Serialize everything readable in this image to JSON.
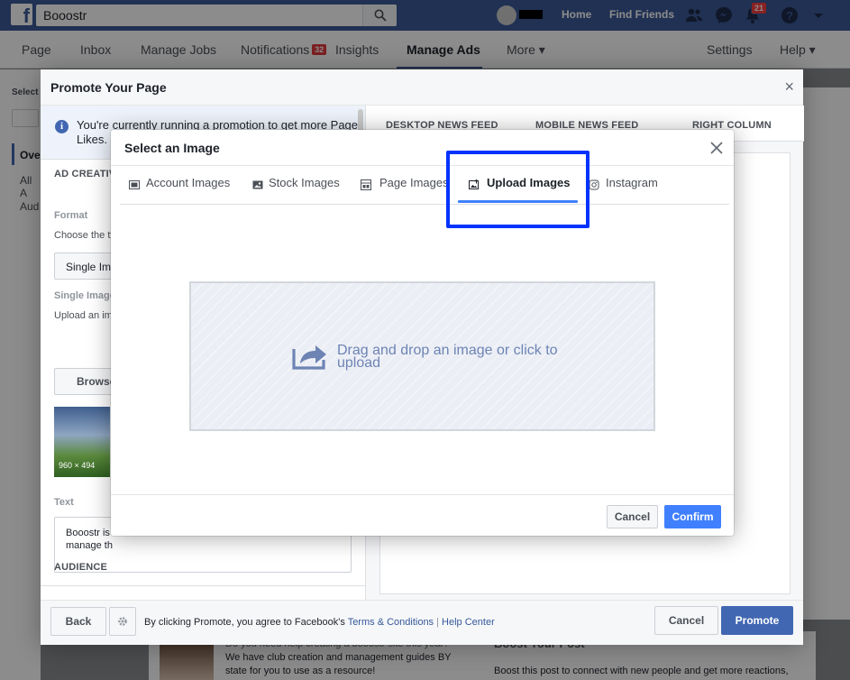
{
  "topbar": {
    "logo": "f",
    "search_value": "Booostr",
    "home_label": "Home",
    "find_friends_label": "Find Friends",
    "notifications_count": "21"
  },
  "navbar": {
    "items": {
      "page": "Page",
      "inbox": "Inbox",
      "manage_jobs": "Manage Jobs",
      "notifications": "Notifications",
      "notifications_badge": "32",
      "insights": "Insights",
      "manage_ads": "Manage Ads",
      "more": "More ▾",
      "settings": "Settings",
      "help": "Help ▾"
    }
  },
  "background": {
    "side_select": "Select",
    "side_ov": "Ove",
    "side_all": "All A",
    "side_aud": "Aud",
    "bottom_left_text_1": "Do you need help creating a booostr site this year?",
    "bottom_left_text_2": "We have club creation and management guides BY",
    "bottom_left_text_3": "state for you to use as a resource!",
    "bottom_right_title": "Boost Your Post",
    "bottom_right_text": "Boost this post to connect with new people and get more reactions,"
  },
  "promote": {
    "title": "Promote Your Page",
    "close": "×",
    "info_icon": "i",
    "info_text": "You're currently running a promotion to get more Page Likes. I",
    "ad_creative_label": "AD CREATIVE",
    "format_label": "Format",
    "format_help": "Choose the ty",
    "format_value": "Single Ima",
    "single_image_label": "Single Image",
    "upload_help": "Upload an im",
    "browse_button": "Browse I",
    "thumb_size": "960 × 494",
    "text_label": "Text",
    "text_value_1": "Booostr is",
    "text_value_2": "manage th",
    "audience_label": "AUDIENCE",
    "preview_tabs": {
      "desktop": "DESKTOP NEWS FEED",
      "mobile": "MOBILE NEWS FEED",
      "right": "RIGHT COLUMN"
    },
    "footer": {
      "back": "Back",
      "agree_prefix": "By clicking Promote, you agree to Facebook's ",
      "terms": "Terms & Conditions",
      "separator": " | ",
      "help_center": "Help Center",
      "cancel": "Cancel",
      "promote": "Promote"
    }
  },
  "modal": {
    "title": "Select an Image",
    "tabs": {
      "account": "Account Images",
      "stock": "Stock Images",
      "page": "Page Images",
      "upload": "Upload Images",
      "instagram": "Instagram"
    },
    "active_tab": "Upload Images",
    "dropzone_text": "Drag and drop an image or click to upload",
    "cancel": "Cancel",
    "confirm": "Confirm"
  },
  "colors": {
    "facebook_blue": "#3b5998",
    "accent_blue": "#4080ff",
    "highlight_box": "#0033ff",
    "badge_red": "#fa3e3e"
  }
}
